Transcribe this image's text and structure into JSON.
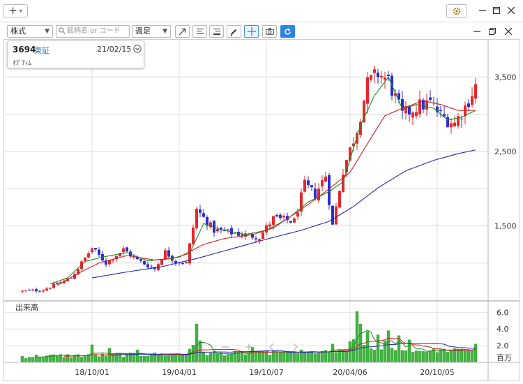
{
  "window": {
    "add_label": "+",
    "controls": [
      "minimize",
      "maximize",
      "close"
    ]
  },
  "toolbar": {
    "market_select": "株式",
    "search_placeholder": "銘柄名 or コード",
    "period_select": "週足",
    "tool_icons": [
      "trendline-icon",
      "text-align-icon",
      "indicator-icon",
      "pen-icon",
      "crosshair-icon",
      "camera-icon",
      "refresh-icon"
    ]
  },
  "info": {
    "code": "3694",
    "market": "東証",
    "date": "21/02/15",
    "name": "ｵﾌﾟﾃｨﾑ"
  },
  "colors": {
    "up": "#e8262b",
    "down": "#2b2bd6",
    "ma_short": "#1c8c1c",
    "ma_mid": "#d42020",
    "ma_long": "#2626b8",
    "volume": "#41b541"
  },
  "chart_data": {
    "type": "candlestick",
    "x_axis_ticks": [
      "18/10/01",
      "19/04/01",
      "19/10/07",
      "20/04/06",
      "20/10/05"
    ],
    "price_axis": {
      "ticks": [
        "1,500",
        "2,500",
        "3,500"
      ],
      "tick_values": [
        1500,
        2500,
        3500
      ],
      "range": [
        500,
        4000
      ]
    },
    "volume_panel": {
      "label": "出来高",
      "ticks": [
        "6.0",
        "4.0",
        "2.0"
      ],
      "tick_values": [
        6,
        4,
        2
      ],
      "unit": "百万",
      "range": [
        0,
        7.2
      ]
    },
    "close_anchors": [
      [
        0,
        620
      ],
      [
        6,
        640
      ],
      [
        10,
        720
      ],
      [
        14,
        800
      ],
      [
        20,
        1200
      ],
      [
        24,
        1000
      ],
      [
        29,
        1180
      ],
      [
        33,
        1040
      ],
      [
        38,
        920
      ],
      [
        41,
        1150
      ],
      [
        44,
        1020
      ],
      [
        47,
        1000
      ],
      [
        50,
        1720
      ],
      [
        55,
        1440
      ],
      [
        61,
        1400
      ],
      [
        68,
        1350
      ],
      [
        72,
        1600
      ],
      [
        78,
        1560
      ],
      [
        81,
        2050
      ],
      [
        84,
        1920
      ],
      [
        87,
        2180
      ],
      [
        89,
        1500
      ],
      [
        92,
        2250
      ],
      [
        96,
        2800
      ],
      [
        99,
        3400
      ],
      [
        102,
        3550
      ],
      [
        105,
        3450
      ],
      [
        109,
        2980
      ],
      [
        113,
        3100
      ],
      [
        117,
        3150
      ],
      [
        120,
        2980
      ],
      [
        124,
        2880
      ],
      [
        127,
        3100
      ],
      [
        130,
        3380
      ]
    ],
    "sma13": [
      [
        8,
        720
      ],
      [
        13,
        800
      ],
      [
        18,
        1020
      ],
      [
        23,
        1080
      ],
      [
        30,
        1140
      ],
      [
        36,
        1030
      ],
      [
        43,
        1060
      ],
      [
        48,
        1130
      ],
      [
        52,
        1530
      ],
      [
        57,
        1450
      ],
      [
        64,
        1380
      ],
      [
        70,
        1440
      ],
      [
        76,
        1590
      ],
      [
        82,
        1820
      ],
      [
        88,
        1960
      ],
      [
        92,
        2090
      ],
      [
        97,
        2850
      ],
      [
        101,
        3250
      ],
      [
        105,
        3500
      ],
      [
        109,
        3070
      ],
      [
        113,
        3130
      ],
      [
        118,
        3080
      ],
      [
        122,
        2920
      ],
      [
        126,
        2960
      ],
      [
        130,
        3050
      ]
    ],
    "sma26": [
      [
        10,
        700
      ],
      [
        16,
        860
      ],
      [
        22,
        1000
      ],
      [
        30,
        1100
      ],
      [
        38,
        1040
      ],
      [
        45,
        1080
      ],
      [
        52,
        1250
      ],
      [
        58,
        1330
      ],
      [
        66,
        1380
      ],
      [
        72,
        1470
      ],
      [
        80,
        1720
      ],
      [
        87,
        1960
      ],
      [
        94,
        2220
      ],
      [
        100,
        2680
      ],
      [
        104,
        2980
      ],
      [
        109,
        3080
      ],
      [
        115,
        3180
      ],
      [
        120,
        3130
      ],
      [
        125,
        3050
      ],
      [
        130,
        3050
      ]
    ],
    "sma52": [
      [
        20,
        800
      ],
      [
        30,
        880
      ],
      [
        40,
        950
      ],
      [
        50,
        1060
      ],
      [
        60,
        1190
      ],
      [
        70,
        1320
      ],
      [
        80,
        1440
      ],
      [
        88,
        1560
      ],
      [
        95,
        1760
      ],
      [
        102,
        2010
      ],
      [
        110,
        2240
      ],
      [
        118,
        2380
      ],
      [
        125,
        2470
      ],
      [
        130,
        2520
      ]
    ],
    "volume_spikes": [
      [
        20,
        2.1
      ],
      [
        25,
        1.7
      ],
      [
        33,
        1.5
      ],
      [
        48,
        1.6
      ],
      [
        50,
        4.6
      ],
      [
        51,
        2.6
      ],
      [
        66,
        1.8
      ],
      [
        73,
        1.3
      ],
      [
        80,
        1.5
      ],
      [
        89,
        2.2
      ],
      [
        94,
        2.5
      ],
      [
        96,
        6.1
      ],
      [
        97,
        4.6
      ],
      [
        99,
        3.7
      ],
      [
        102,
        3.3
      ],
      [
        104,
        2.6
      ],
      [
        105,
        3.8
      ],
      [
        108,
        3.2
      ],
      [
        111,
        2.7
      ],
      [
        118,
        1.4
      ],
      [
        130,
        2.2
      ]
    ],
    "volume_base": 0.45
  },
  "watermark": {
    "icons": [
      "zoom-out-icon",
      "zoom-in-icon",
      "scroll-left-icon",
      "scroll-right-icon"
    ]
  }
}
